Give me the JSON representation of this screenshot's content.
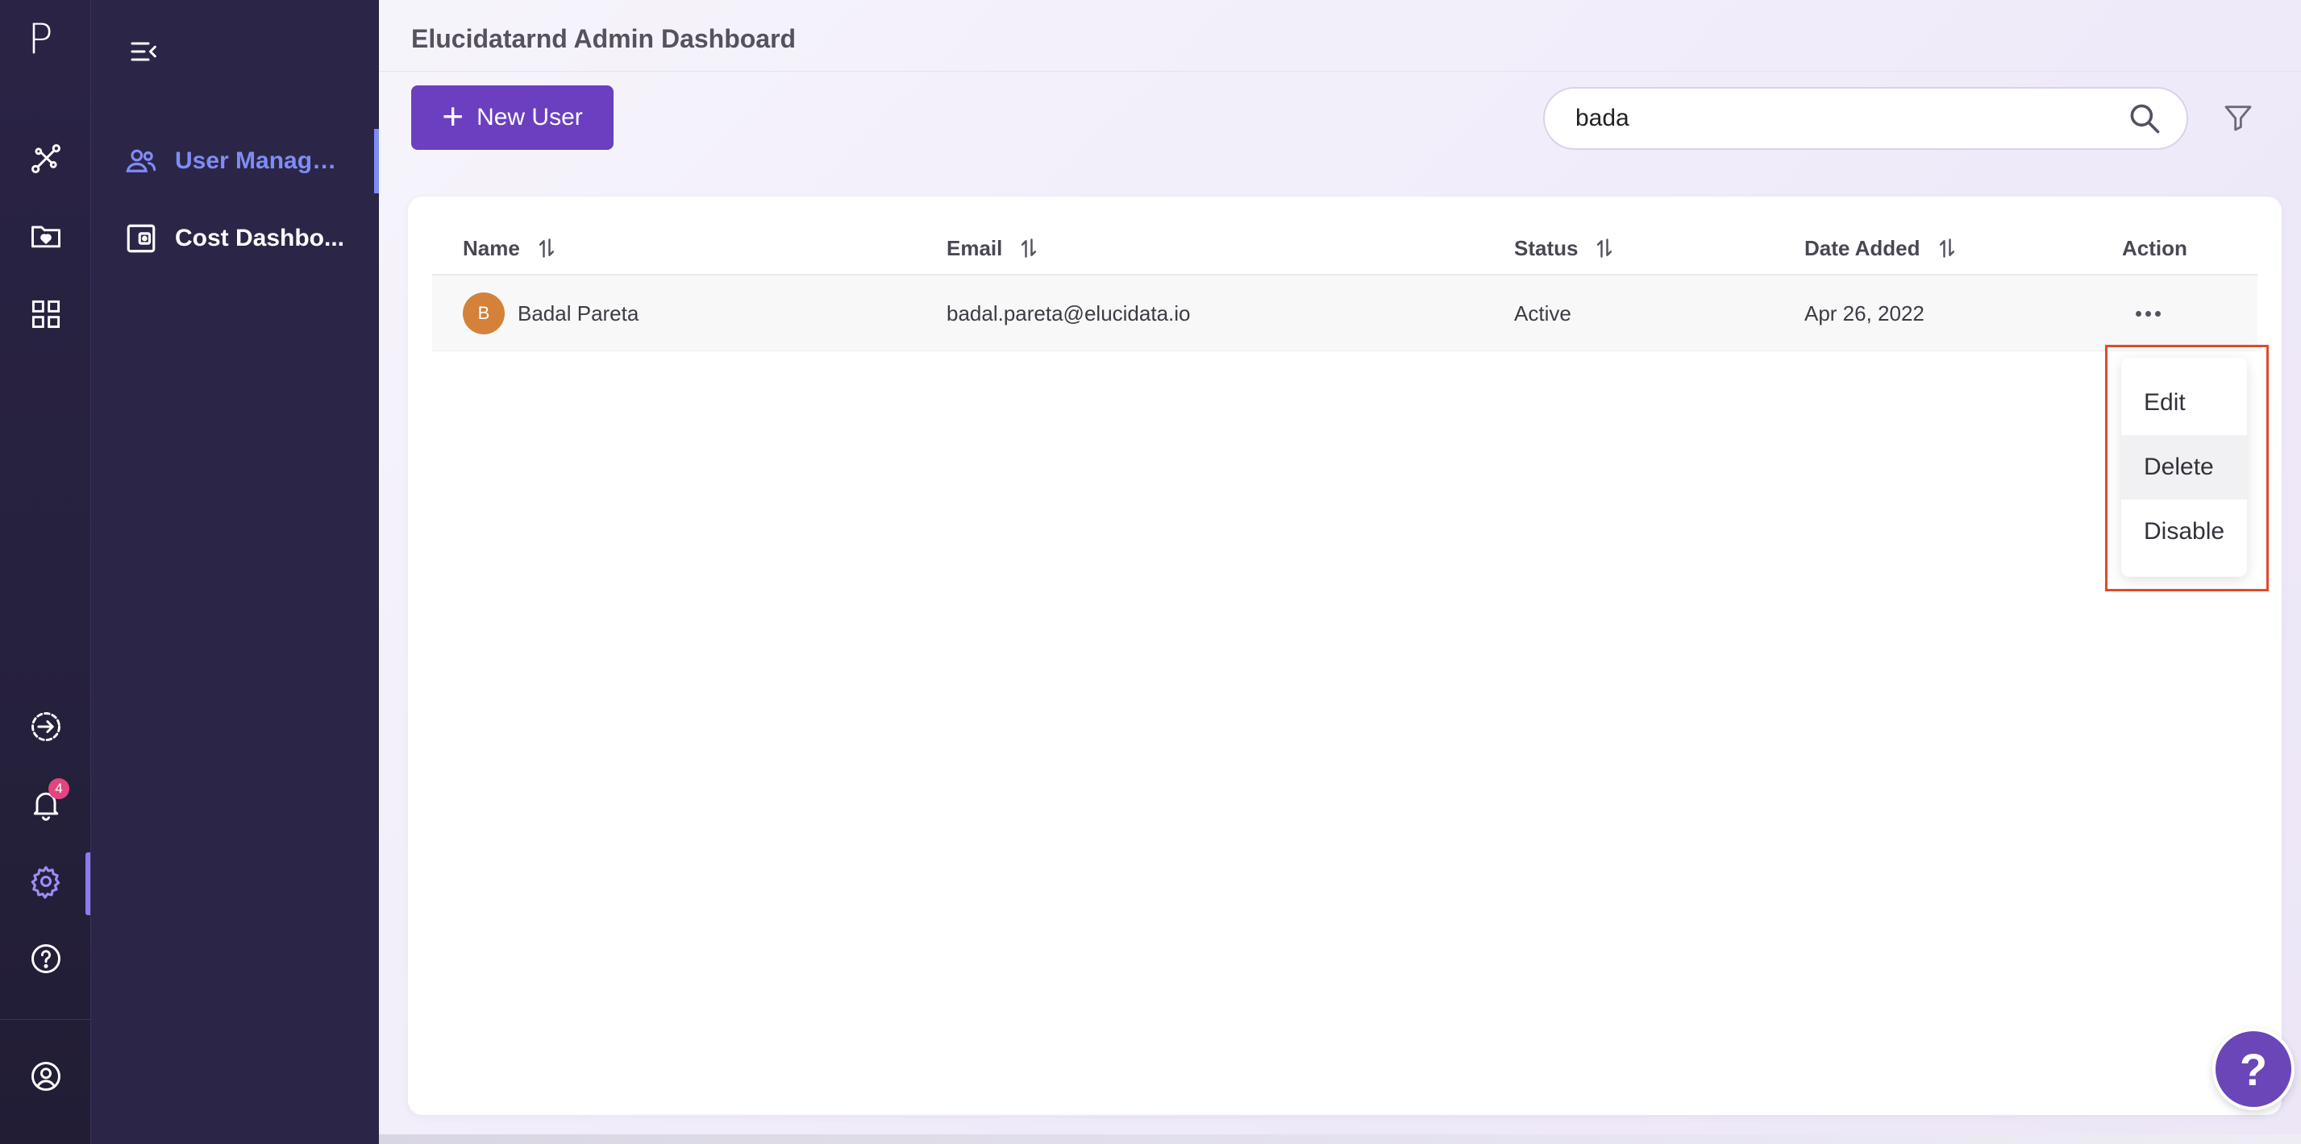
{
  "app": {
    "logo_letter": "P",
    "notification_count": "4"
  },
  "sidebar": {
    "items": [
      {
        "label": "User Manage...",
        "icon": "users-icon",
        "active": true
      },
      {
        "label": "Cost Dashbo...",
        "icon": "wallet-icon",
        "active": false
      }
    ]
  },
  "header": {
    "title": "Elucidatarnd Admin Dashboard"
  },
  "toolbar": {
    "new_user_label": "New User",
    "search_value": "bada"
  },
  "table": {
    "columns": [
      "Name",
      "Email",
      "Status",
      "Date Added",
      "Action"
    ],
    "rows": [
      {
        "avatar_letter": "B",
        "name": "Badal Pareta",
        "email": "badal.pareta@elucidata.io",
        "status": "Active",
        "date_added": "Apr 26, 2022"
      }
    ]
  },
  "action_menu": {
    "items": [
      "Edit",
      "Delete",
      "Disable"
    ],
    "hovered": "Delete"
  },
  "help": {
    "label": "?"
  },
  "colors": {
    "accent": "#6b3fbf",
    "active_nav": "#7f8cf6",
    "highlight_box": "#e04a2d",
    "avatar": "#d4823a",
    "badge": "#e2457f"
  }
}
